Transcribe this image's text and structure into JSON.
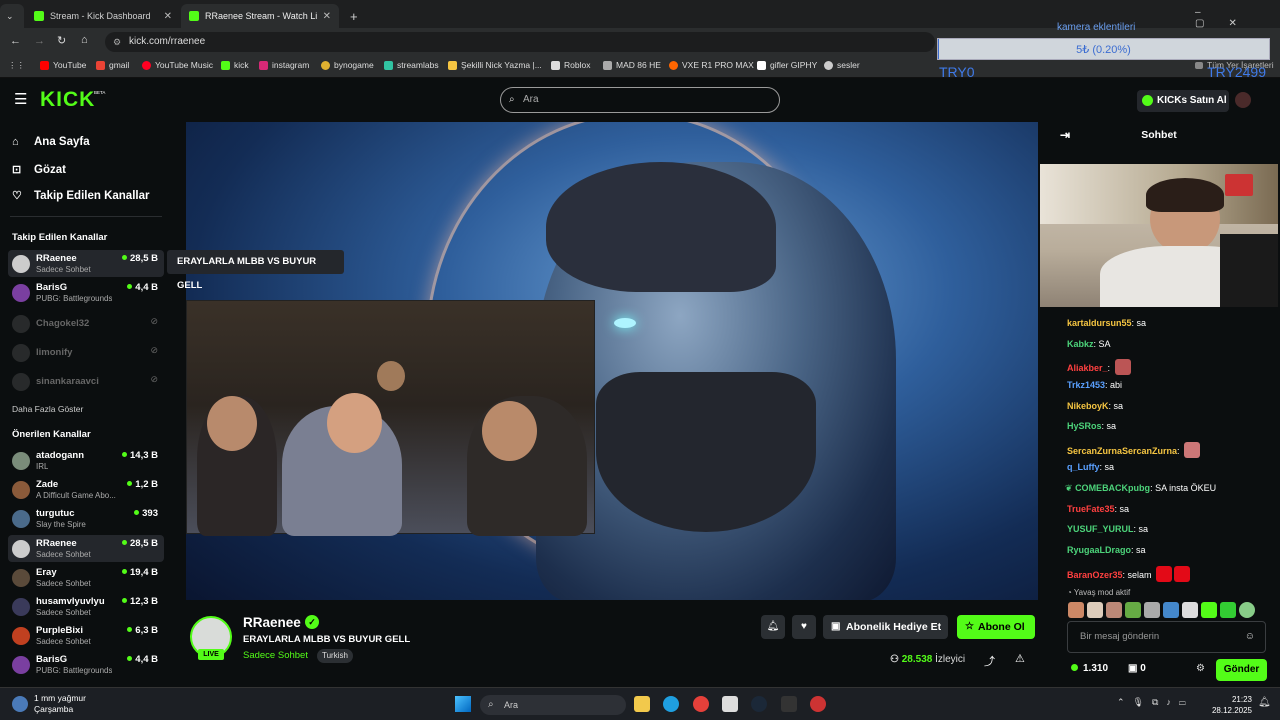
{
  "browser": {
    "tabs": [
      {
        "label": "Stream - Kick Dashboard"
      },
      {
        "label": "RRaenee Stream - Watch Li"
      }
    ],
    "new_tab": "+",
    "url": "kick.com/rraenee",
    "bookmarks": [
      "YouTube",
      "gmail",
      "YouTube Music",
      "kick",
      "instagram",
      "bynogame",
      "streamlabs",
      "Şekilli Nick Yazma |...",
      "Roblox",
      "MAD 86 HE",
      "VXE R1 PRO MAX",
      "gifler GIPHY",
      "sesler"
    ],
    "all_bookmarks": "Tüm Yer İşaretleri"
  },
  "overlay": {
    "title": "kamera eklentileri",
    "value": "5₺ (0.20%)",
    "min_label": "TRY0",
    "max_label": "TRY2499",
    "progress_percent": 0.2
  },
  "header": {
    "logo": "KICK",
    "logo_beta": "BETA",
    "search_placeholder": "Ara",
    "buy_kicks": "KICKs Satın Al"
  },
  "sidebar": {
    "nav": [
      {
        "label": "Ana Sayfa",
        "icon": "home-icon"
      },
      {
        "label": "Gözat",
        "icon": "compass-icon"
      },
      {
        "label": "Takip Edilen Kanallar",
        "icon": "heart-icon"
      }
    ],
    "followed_title": "Takip Edilen Kanallar",
    "followed": [
      {
        "name": "RRaenee",
        "category": "Sadece Sohbet",
        "viewers": "28,5 B"
      },
      {
        "name": "BarisG",
        "category": "PUBG: Battlegrounds",
        "viewers": "4,4 B"
      },
      {
        "name": "Chagokel32",
        "category": "",
        "viewers": ""
      },
      {
        "name": "limonify",
        "category": "",
        "viewers": ""
      },
      {
        "name": "sinankaraavci",
        "category": "",
        "viewers": ""
      }
    ],
    "show_more": "Daha Fazla Göster",
    "recommended_title": "Önerilen Kanallar",
    "recommended": [
      {
        "name": "atadogann",
        "category": "IRL",
        "viewers": "14,3 B"
      },
      {
        "name": "Zade",
        "category": "A Difficult Game Abo...",
        "viewers": "1,2 B"
      },
      {
        "name": "turgutuc",
        "category": "Slay the Spire",
        "viewers": "393"
      },
      {
        "name": "RRaenee",
        "category": "Sadece Sohbet",
        "viewers": "28,5 B"
      },
      {
        "name": "Eray",
        "category": "Sadece Sohbet",
        "viewers": "19,4 B"
      },
      {
        "name": "husamvlyuvlyu",
        "category": "Sadece Sohbet",
        "viewers": "12,3 B"
      },
      {
        "name": "PurpleBixi",
        "category": "Sadece Sohbet",
        "viewers": "6,3 B"
      },
      {
        "name": "BarisG",
        "category": "PUBG: Battlegrounds",
        "viewers": "4,4 B"
      }
    ],
    "tooltip": "ERAYLARLA MLBB VS BUYUR GELL"
  },
  "stream": {
    "channel": "RRaenee",
    "title": "ERAYLARLA MLBB VS BUYUR GELL",
    "category": "Sadece Sohbet",
    "tag": "Turkish",
    "live": "LIVE",
    "gift_label": "Abonelik Hediye Et",
    "subscribe_label": "Abone Ol",
    "viewers": "28.538",
    "viewers_label": "İzleyici"
  },
  "chat": {
    "title": "Sohbet",
    "messages": [
      {
        "user": "kartaldursun55",
        "text": "sa",
        "color": "#f5c542"
      },
      {
        "user": "Kabkz",
        "text": "SA",
        "color": "#4cd37a"
      },
      {
        "user": "Aliakber_",
        "text": "",
        "color": "#ff4040"
      },
      {
        "user": "Trkz1453",
        "text": "abi",
        "color": "#5aa0ff"
      },
      {
        "user": "NikeboyK",
        "text": "sa",
        "color": "#f5c542"
      },
      {
        "user": "HySRos",
        "text": "sa",
        "color": "#4cd37a"
      },
      {
        "user": "SercanZurnaSercanZurna",
        "text": "",
        "color": "#f5c542"
      },
      {
        "user": "q_Luffy",
        "text": "sa",
        "color": "#5aa0ff"
      },
      {
        "user": "COMEBACKpubg",
        "text": "SA insta ÖKEU",
        "color": "#4cd37a"
      },
      {
        "user": "TrueFate35",
        "text": "sa",
        "color": "#ff4040"
      },
      {
        "user": "YUSUF_YURUL",
        "text": "sa",
        "color": "#4cd37a"
      },
      {
        "user": "RyugaaLDrago",
        "text": "sa",
        "color": "#4cd37a"
      },
      {
        "user": "BaranOzer35",
        "text": "selam",
        "color": "#ff4040"
      }
    ],
    "slow_mode": "Yavaş mod aktif",
    "input_placeholder": "Bir mesaj gönderin",
    "kicks_balance": "1.310",
    "gifts_count": "0",
    "send_label": "Gönder"
  },
  "taskbar": {
    "weather_temp": "1 mm yağmur",
    "weather_day": "Çarşamba",
    "search_placeholder": "Ara",
    "time": "21:23",
    "date": "28.12.2025"
  },
  "colors": {
    "accent": "#53fc18",
    "background": "#0b0e0f"
  }
}
